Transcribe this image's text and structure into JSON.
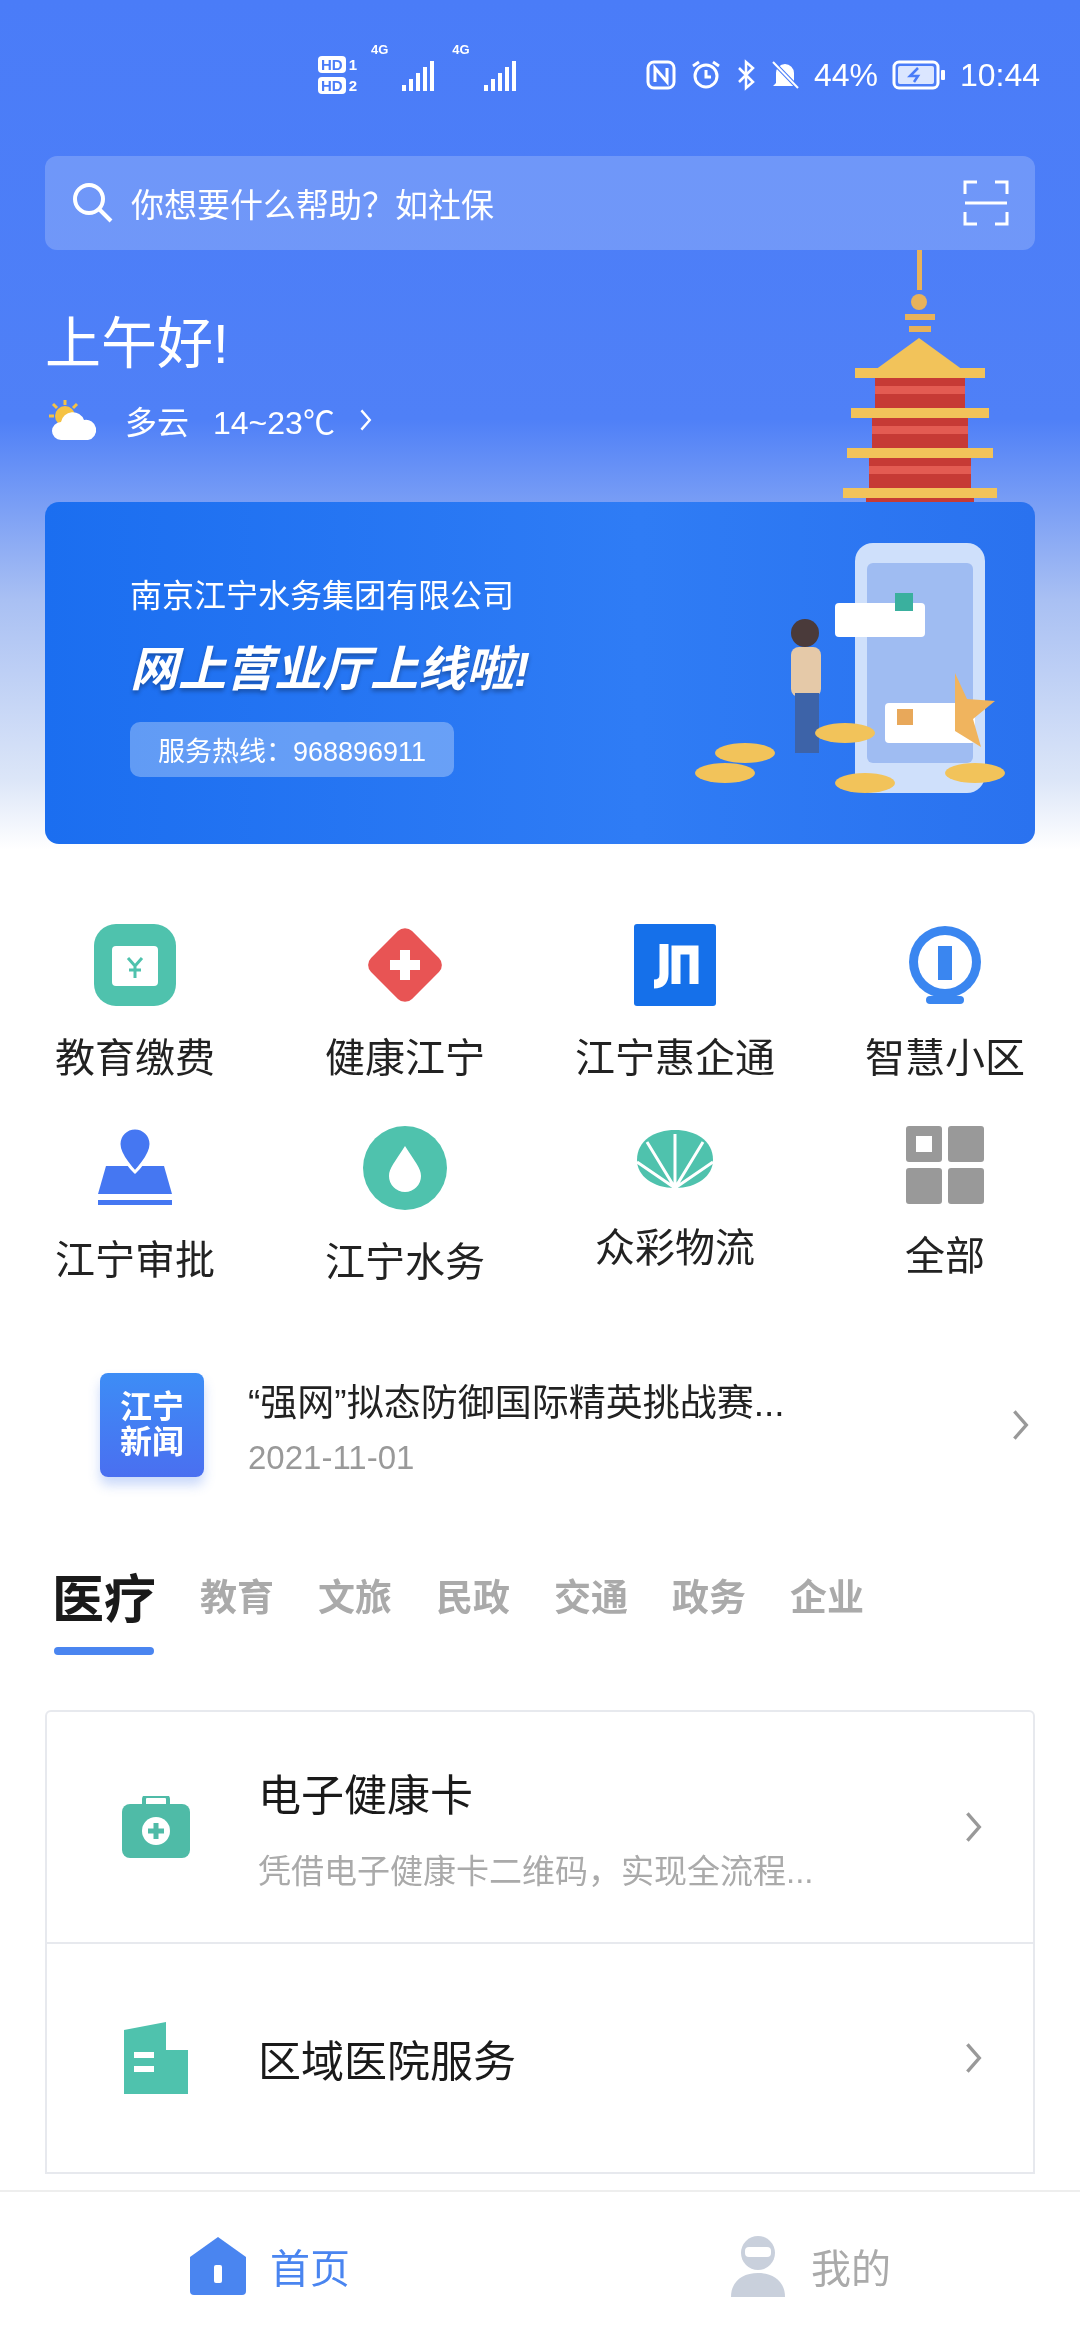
{
  "status_bar": {
    "sims": [
      {
        "hd": "HD",
        "slot": "1",
        "network": "4G"
      },
      {
        "hd": "HD",
        "slot": "2",
        "network": "4G"
      }
    ],
    "battery": "44%",
    "time": "10:44"
  },
  "search": {
    "placeholder": "你想要什么帮助？如社保"
  },
  "greeting": "上午好!",
  "weather": {
    "condition": "多云",
    "temperature": "14~23℃"
  },
  "banner": {
    "company": "南京江宁水务集团有限公司",
    "headline": "网上营业厅上线啦!",
    "hotline": "服务热线：968896911"
  },
  "services": [
    {
      "label": "教育缴费"
    },
    {
      "label": "健康江宁"
    },
    {
      "label": "江宁惠企通"
    },
    {
      "label": "智慧小区"
    },
    {
      "label": "江宁审批"
    },
    {
      "label": "江宁水务"
    },
    {
      "label": "众彩物流"
    },
    {
      "label": "全部"
    }
  ],
  "news": {
    "badge": [
      "江宁",
      "新闻"
    ],
    "title": "“强网”拟态防御国际精英挑战赛...",
    "date": "2021-11-01"
  },
  "category_tabs": [
    {
      "label": "医疗",
      "selected": true
    },
    {
      "label": "教育",
      "selected": false
    },
    {
      "label": "文旅",
      "selected": false
    },
    {
      "label": "民政",
      "selected": false
    },
    {
      "label": "交通",
      "selected": false
    },
    {
      "label": "政务",
      "selected": false
    },
    {
      "label": "企业",
      "selected": false
    }
  ],
  "service_cards": [
    {
      "title": "电子健康卡",
      "subtitle": "凭借电子健康卡二维码，实现全流程..."
    },
    {
      "title": "区域医院服务"
    }
  ],
  "bottom_nav": [
    {
      "label": "首页",
      "selected": true
    },
    {
      "label": "我的",
      "selected": false
    }
  ]
}
